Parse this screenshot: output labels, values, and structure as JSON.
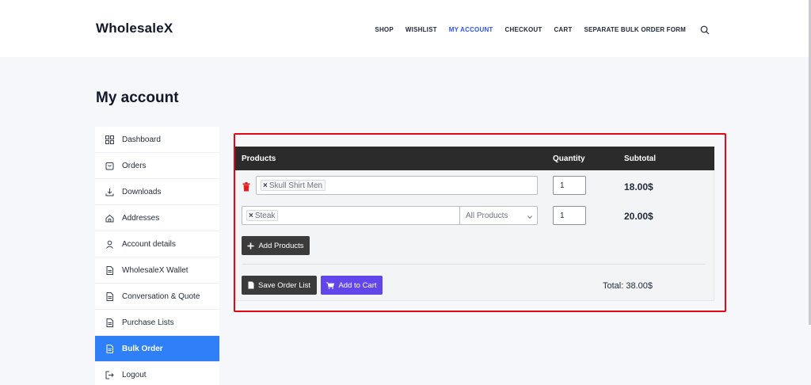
{
  "header": {
    "logo": "WholesaleX",
    "nav": [
      {
        "label": "SHOP"
      },
      {
        "label": "WISHLIST"
      },
      {
        "label": "MY ACCOUNT"
      },
      {
        "label": "CHECKOUT"
      },
      {
        "label": "CART"
      },
      {
        "label": "SEPARATE BULK ORDER FORM"
      }
    ],
    "active_nav": "MY ACCOUNT",
    "search_icon": "search-icon"
  },
  "page": {
    "title": "My account"
  },
  "sidebar": {
    "items": [
      {
        "label": "Dashboard",
        "icon": "dashboard-icon"
      },
      {
        "label": "Orders",
        "icon": "orders-icon"
      },
      {
        "label": "Downloads",
        "icon": "download-icon"
      },
      {
        "label": "Addresses",
        "icon": "home-icon"
      },
      {
        "label": "Account details",
        "icon": "user-icon"
      },
      {
        "label": "WholesaleX Wallet",
        "icon": "document-icon"
      },
      {
        "label": "Conversation & Quote",
        "icon": "document-icon"
      },
      {
        "label": "Purchase Lists",
        "icon": "document-icon"
      },
      {
        "label": "Bulk Order",
        "icon": "document-icon",
        "active": true
      },
      {
        "label": "Logout",
        "icon": "logout-icon"
      }
    ]
  },
  "bulk_order": {
    "headers": {
      "products": "Products",
      "quantity": "Quantity",
      "subtotal": "Subtotal"
    },
    "rows": [
      {
        "product": "Skull Shirt Men",
        "quantity": "1",
        "subtotal": "18.00$"
      },
      {
        "product": "Steak",
        "filter": "All Products",
        "quantity": "1",
        "subtotal": "20.00$"
      }
    ],
    "add_products_label": "Add Products",
    "save_list_label": "Save Order List",
    "add_to_cart_label": "Add to Cart",
    "total_label": "Total: 38.00$"
  },
  "colors": {
    "accent": "#2f54eb",
    "sidebar_active": "#2f7ff8",
    "highlight_border": "#e30613",
    "table_header": "#2b2b2b",
    "add_to_cart": "#6246ea",
    "trash": "#e11d1d"
  }
}
